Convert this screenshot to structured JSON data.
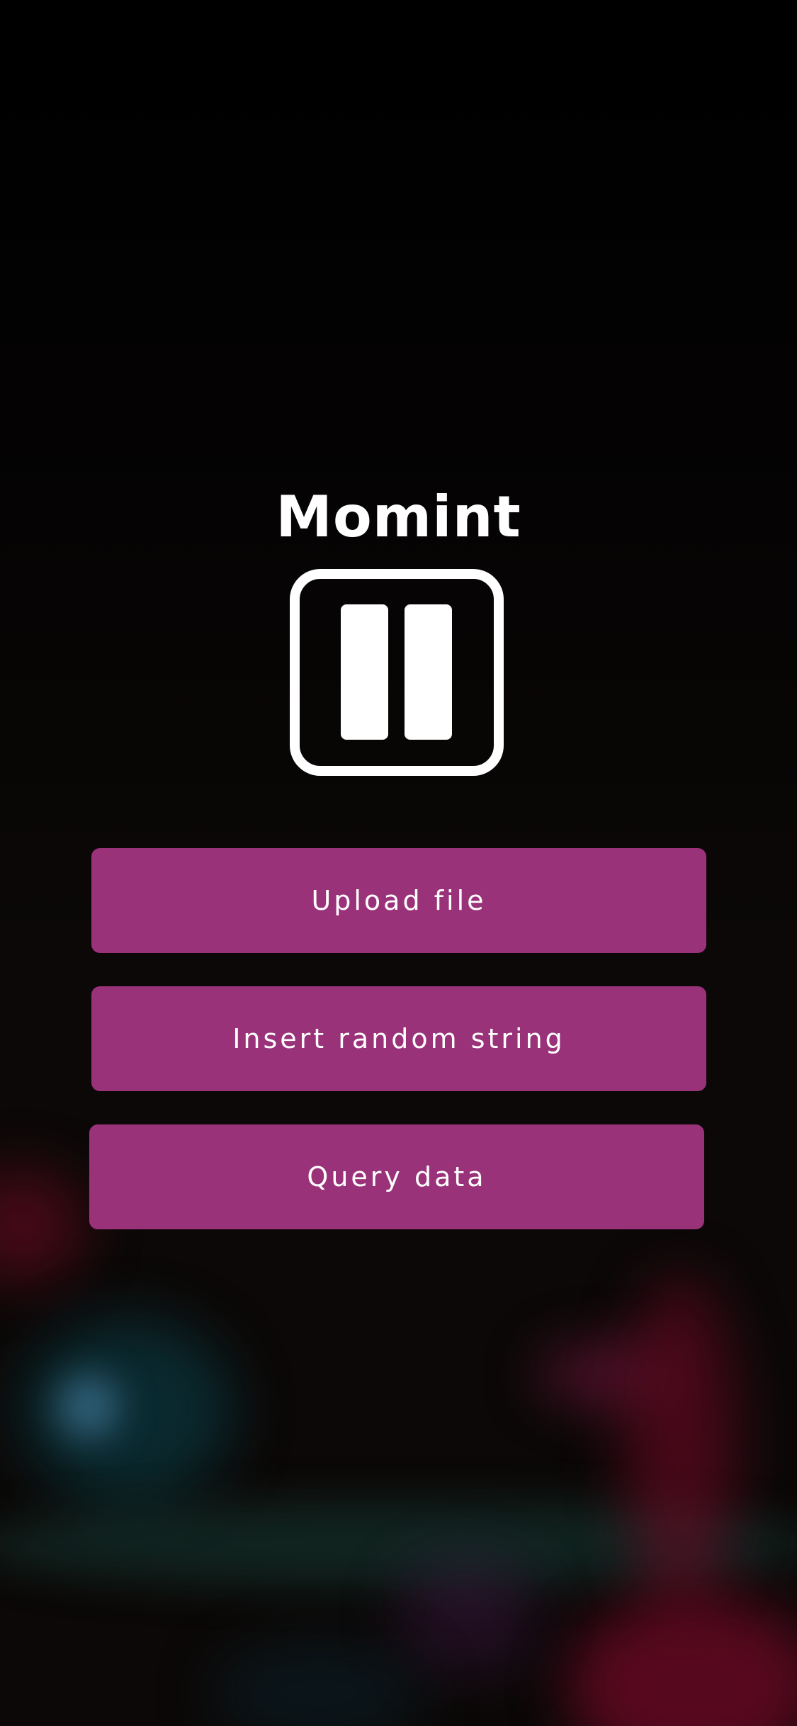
{
  "app": {
    "title": "Momint",
    "logo_icon": "pause-square-icon"
  },
  "actions": {
    "upload_label": "Upload file",
    "insert_label": "Insert random string",
    "query_label": "Query data"
  },
  "colors": {
    "button_background": "#9a327a",
    "text": "#ffffff",
    "background": "#0b0807"
  }
}
